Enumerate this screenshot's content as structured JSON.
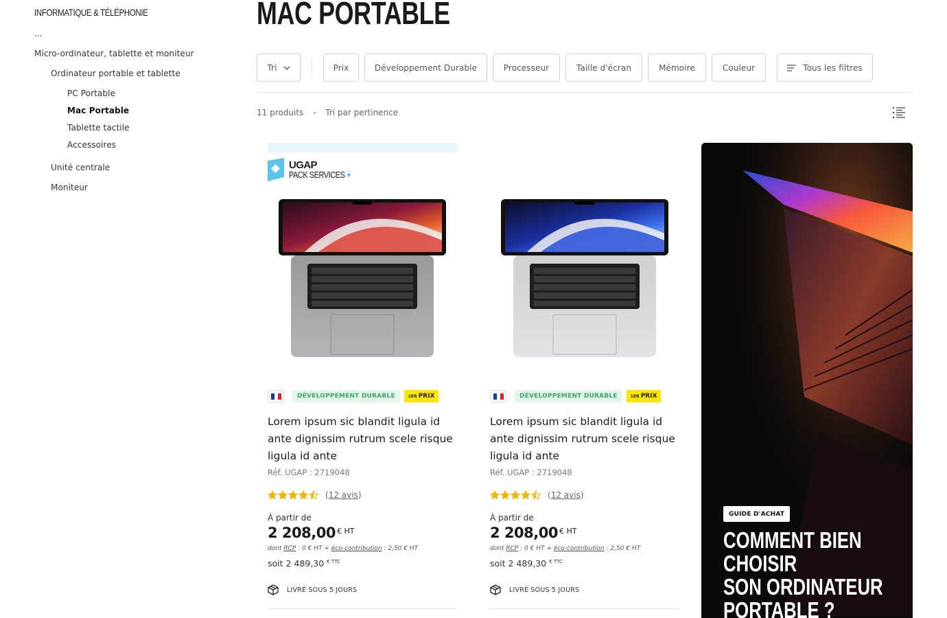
{
  "sidebar": {
    "category": "INFORMATIQUE & TÉLÉPHONIE",
    "ellipsis": "...",
    "level1": "Micro-ordinateur, tablette et moniteur",
    "level2_a": "Ordinateur portable et tablette",
    "level3": [
      "PC Portable",
      "Mac Portable",
      "Tablette tactile",
      "Accessoires"
    ],
    "level2_b": "Unité centrale",
    "level2_c": "Moniteur"
  },
  "page_title": "MAC PORTABLE",
  "filters": {
    "sort_label": "Tri",
    "items": [
      "Prix",
      "Développement Durable",
      "Processeur",
      "Taille d'écran",
      "Mémoire",
      "Couleur"
    ],
    "all_filters": "Tous les filtres"
  },
  "results": {
    "count": "11 produits",
    "dash": "-",
    "sort_text": "Tri par pertinence"
  },
  "ugap": {
    "line1": "UGAP",
    "line2": "PACK SERVICES",
    "plus": "+"
  },
  "products": [
    {
      "badge_dd": "DÉVELOPPEMENT DURABLE",
      "badge_1p_sup": "1ER",
      "badge_1p": "PRIX",
      "title": "Lorem ipsum sic blandit ligula id ante dignissim rutrum scele risque ligula id ante",
      "ref": "Réf. UGAP  : 2719048",
      "rating": 4.5,
      "reviews": "12 avis",
      "from_label": "À partir de",
      "price": "2 208,00",
      "price_unit": "€ HT",
      "dont_prefix": "dont",
      "rcp_label": "RCP",
      "rcp_value": " : 0 € HT  +",
      "eco_label": "éco-contribution",
      "eco_value": " : 2,50 € HT",
      "soit_prefix": "soit",
      "ttc_price": "2 489,30",
      "ttc_unit": "€ TTC",
      "delivery": "LIVRÉ SOUS 5 JOURS"
    },
    {
      "badge_dd": "DÉVELOPPEMENT DURABLE",
      "badge_1p_sup": "1ER",
      "badge_1p": "PRIX",
      "title": "Lorem ipsum sic blandit ligula id ante dignissim rutrum scele risque ligula id ante",
      "ref": "Réf. UGAP  : 2719048",
      "rating": 4.5,
      "reviews": "12 avis",
      "from_label": "À partir de",
      "price": "2 208,00",
      "price_unit": "€ HT",
      "dont_prefix": "dont",
      "rcp_label": "RCP",
      "rcp_value": " : 0 € HT  +",
      "eco_label": "éco-contribution",
      "eco_value": " : 2,50 € HT",
      "soit_prefix": "soit",
      "ttc_price": "2 489,30",
      "ttc_unit": "€ TTC",
      "delivery": "LIVRÉ SOUS 5 JOURS"
    }
  ],
  "promo": {
    "tag": "GUIDE D'ACHAT",
    "title_lines": [
      "COMMENT BIEN",
      "CHOISIR",
      "SON ORDINATEUR",
      "PORTABLE ?"
    ]
  },
  "colors": {
    "dd_badge_bg": "#e3f7ea",
    "dd_badge_text": "#3aa86a",
    "first_price_bg": "#ffe600",
    "star": "#f2b400",
    "ugap_blue": "#2bb3e3"
  }
}
